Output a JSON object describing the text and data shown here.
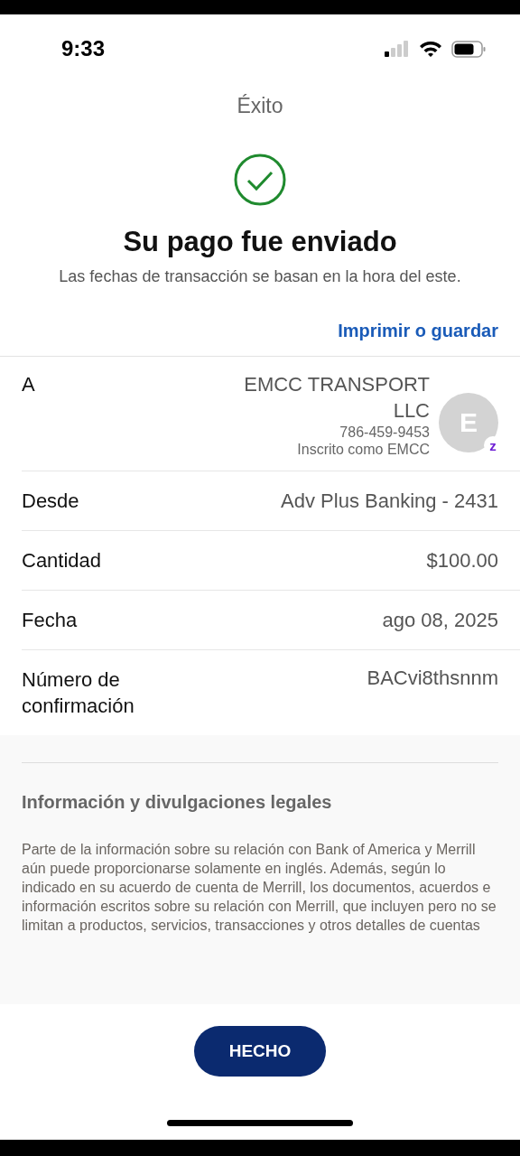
{
  "status_bar": {
    "time": "9:33"
  },
  "header": {
    "title": "Éxito"
  },
  "confirmation": {
    "heading": "Su pago fue enviado",
    "note": "Las fechas de transacción se basan en la hora del este.",
    "print_link": "Imprimir o guardar"
  },
  "recipient": {
    "label": "A",
    "name": "EMCC TRANSPORT LLC",
    "phone": "786-459-9453",
    "enrolled": "Inscrito como EMCC",
    "avatar_initial": "E",
    "badge": "z"
  },
  "details": [
    {
      "label": "Desde",
      "value": "Adv Plus Banking - 2431"
    },
    {
      "label": "Cantidad",
      "value": "$100.00"
    },
    {
      "label": "Fecha",
      "value": "ago 08, 2025"
    },
    {
      "label": "Número de confirmación",
      "value": "BACvi8thsnnm"
    }
  ],
  "legal": {
    "heading": "Información y divulgaciones legales",
    "text": "Parte de la información sobre su relación con Bank of America y Merrill aún puede proporcionarse solamente en inglés. Además, según lo indicado en su acuerdo de cuenta de Merrill, los documentos, acuerdos e información escritos sobre su relación con Merrill, que incluyen pero no se limitan a productos, servicios, transacciones y otros detalles de cuentas"
  },
  "done_button": "HECHO"
}
